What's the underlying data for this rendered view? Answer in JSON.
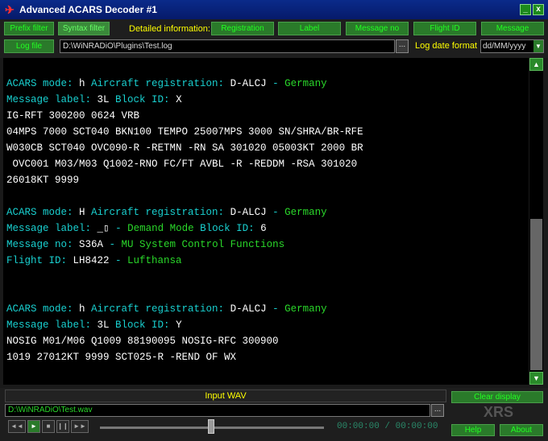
{
  "window": {
    "title": "Advanced ACARS Decoder #1",
    "minimize_label": "_",
    "close_label": "x"
  },
  "toolbar": {
    "buttons": [
      {
        "label": "Prefix filter"
      },
      {
        "label": "Syntax filter"
      }
    ],
    "detailed_label": "Detailed information:",
    "detail_buttons": [
      {
        "label": "Registration"
      },
      {
        "label": "Label"
      },
      {
        "label": "Message no"
      },
      {
        "label": "Flight ID"
      },
      {
        "label": "Message"
      }
    ],
    "log_button": "Log file",
    "log_path": "D:\\WiNRADiO\\Plugins\\Test.log",
    "log_browse": "...",
    "log_date_label": "Log date format",
    "log_date_value": "dd/MM/yyyy"
  },
  "messages": [
    {
      "segments": [
        [
          "c",
          "ACARS mode: "
        ],
        [
          "w",
          "h "
        ],
        [
          "c",
          "Aircraft registration: "
        ],
        [
          "w",
          "D-ALCJ "
        ],
        [
          "c",
          "- "
        ],
        [
          "g",
          "Germany"
        ]
      ]
    },
    {
      "segments": [
        [
          "c",
          "Message label: "
        ],
        [
          "w",
          "3L "
        ],
        [
          "c",
          "Block ID: "
        ],
        [
          "w",
          "X"
        ]
      ]
    },
    {
      "segments": [
        [
          "w",
          "IG-RFT 300200 0624 VRB"
        ]
      ]
    },
    {
      "segments": [
        [
          "w",
          "04MPS 7000 SCT040 BKN100 TEMPO 25007MPS 3000 SN/SHRA/BR-RFE"
        ]
      ]
    },
    {
      "segments": [
        [
          "w",
          "W030CB SCT040 OVC090-R -RETMN -RN SA 301020 05003KT 2000 BR"
        ]
      ]
    },
    {
      "segments": [
        [
          "w",
          " OVC001 M03/M03 Q1002-RNO FC/FT AVBL -R -REDDM -RSA 301020"
        ]
      ]
    },
    {
      "segments": [
        [
          "w",
          "26018KT 9999"
        ]
      ]
    },
    {
      "segments": [
        [
          "w",
          ""
        ]
      ]
    },
    {
      "segments": [
        [
          "c",
          "ACARS mode: "
        ],
        [
          "w",
          "H "
        ],
        [
          "c",
          "Aircraft registration: "
        ],
        [
          "w",
          "D-ALCJ "
        ],
        [
          "c",
          "- "
        ],
        [
          "g",
          "Germany"
        ]
      ]
    },
    {
      "segments": [
        [
          "c",
          "Message label: "
        ],
        [
          "w",
          "_▯ "
        ],
        [
          "c",
          "- "
        ],
        [
          "g",
          "Demand Mode "
        ],
        [
          "c",
          "Block ID: "
        ],
        [
          "w",
          "6"
        ]
      ]
    },
    {
      "segments": [
        [
          "c",
          "Message no: "
        ],
        [
          "w",
          "S36A "
        ],
        [
          "c",
          "- "
        ],
        [
          "g",
          "MU System Control Functions"
        ]
      ]
    },
    {
      "segments": [
        [
          "c",
          "Flight ID: "
        ],
        [
          "w",
          "LH8422 "
        ],
        [
          "c",
          "- "
        ],
        [
          "g",
          "Lufthansa"
        ]
      ]
    },
    {
      "segments": [
        [
          "w",
          ""
        ]
      ]
    },
    {
      "segments": [
        [
          "w",
          ""
        ]
      ]
    },
    {
      "segments": [
        [
          "c",
          "ACARS mode: "
        ],
        [
          "w",
          "h "
        ],
        [
          "c",
          "Aircraft registration: "
        ],
        [
          "w",
          "D-ALCJ "
        ],
        [
          "c",
          "- "
        ],
        [
          "g",
          "Germany"
        ]
      ]
    },
    {
      "segments": [
        [
          "c",
          "Message label: "
        ],
        [
          "w",
          "3L "
        ],
        [
          "c",
          "Block ID: "
        ],
        [
          "w",
          "Y"
        ]
      ]
    },
    {
      "segments": [
        [
          "w",
          "NOSIG M01/M06 Q1009 88190095 NOSIG-RFC 300900"
        ]
      ]
    },
    {
      "segments": [
        [
          "w",
          "1019 27012KT 9999 SCT025-R -REND OF WX"
        ]
      ]
    }
  ],
  "bottom": {
    "input_wav_label": "Input WAV",
    "wav_path": "D:\\WiNRADiO\\Test.wav",
    "wav_browse": "...",
    "clear_display": "Clear display",
    "brand": "XRS",
    "help": "Help",
    "about": "About",
    "time": "00:00:00 / 00:00:00",
    "playback_icons": [
      "rewind-icon",
      "play-icon",
      "stop-icon",
      "pause-icon",
      "fast-forward-icon"
    ],
    "playback_glyphs": [
      "◄◄",
      "►",
      "■",
      "❙❙",
      "►►"
    ]
  },
  "colors": {
    "field_name": "#19d0d0",
    "field_value": "#ffffff",
    "decoded": "#2ad82a",
    "accent_yellow": "#ffff00"
  }
}
